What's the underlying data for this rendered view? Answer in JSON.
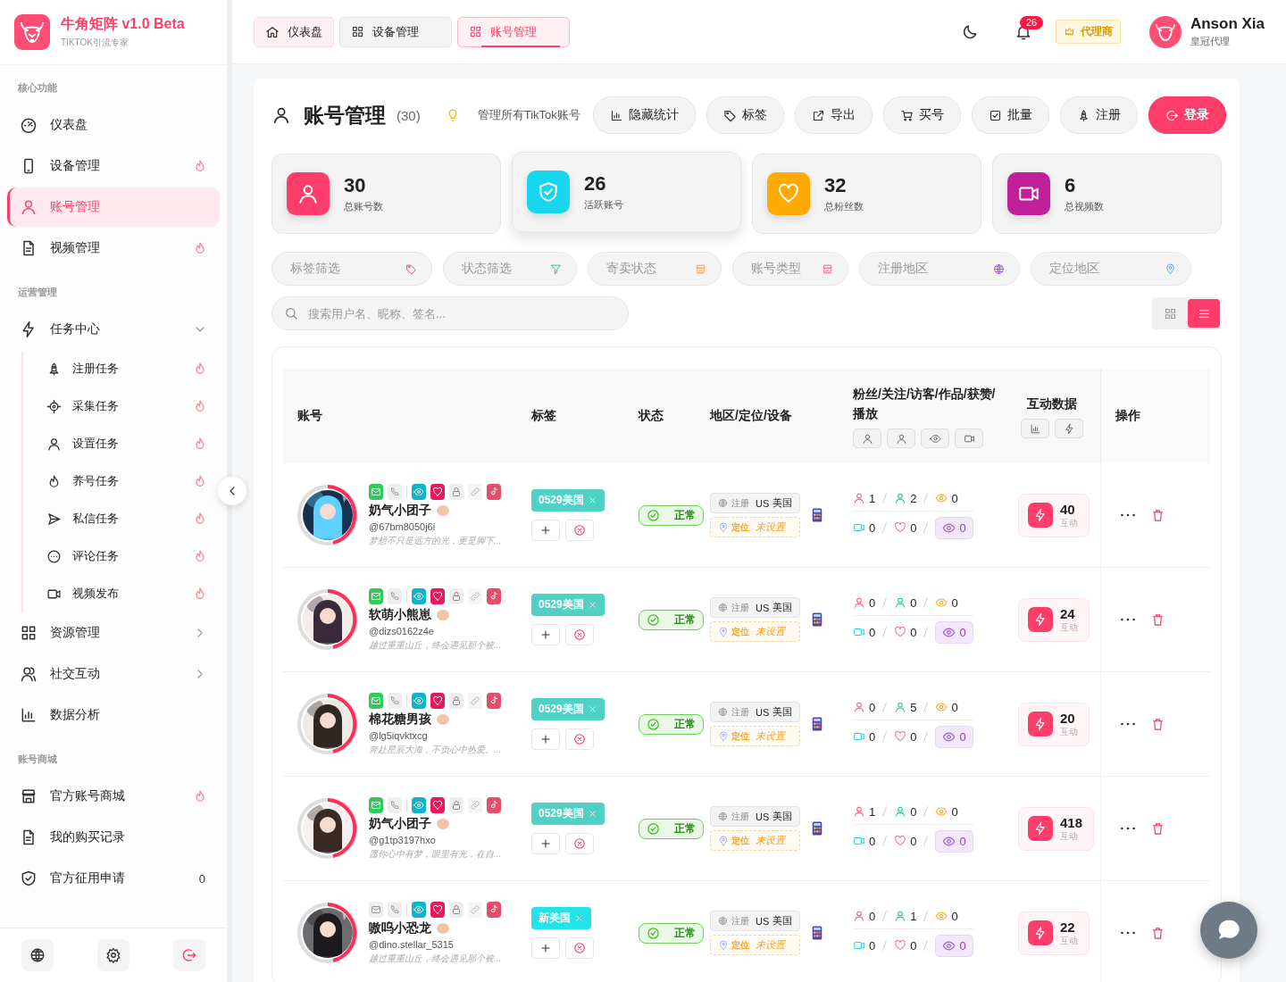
{
  "brand": {
    "name": "牛角矩阵 v1.0 Beta",
    "subtitle": "TIKTOK引流专家"
  },
  "sidebar": {
    "sections": [
      {
        "title": "核心功能",
        "items": [
          {
            "label": "仪表盘",
            "kind": "none",
            "selected": false
          },
          {
            "label": "设备管理",
            "kind": "hot",
            "selected": false
          },
          {
            "label": "账号管理",
            "kind": "none",
            "selected": true
          },
          {
            "label": "视频管理",
            "kind": "hot",
            "selected": false
          }
        ]
      },
      {
        "title": "运营管理",
        "items": [
          {
            "label": "任务中心",
            "kind": "group",
            "expanded": true,
            "selected": false,
            "children": [
              {
                "label": "注册任务",
                "kind": "hot",
                "selected": false
              },
              {
                "label": "采集任务",
                "kind": "hot",
                "selected": false
              },
              {
                "label": "设置任务",
                "kind": "hot",
                "selected": false
              },
              {
                "label": "养号任务",
                "kind": "hot",
                "selected": false
              },
              {
                "label": "私信任务",
                "kind": "hot",
                "selected": false
              },
              {
                "label": "评论任务",
                "kind": "hot",
                "selected": false
              },
              {
                "label": "视频发布",
                "kind": "hot",
                "selected": false
              }
            ]
          },
          {
            "label": "资源管理",
            "kind": "group",
            "expanded": false,
            "selected": false
          },
          {
            "label": "社交互动",
            "kind": "group",
            "expanded": false,
            "selected": false
          },
          {
            "label": "数据分析",
            "kind": "none",
            "selected": false
          }
        ]
      },
      {
        "title": "账号商城",
        "items": [
          {
            "label": "官方账号商城",
            "kind": "hot",
            "selected": false
          },
          {
            "label": "我的购买记录",
            "kind": "none",
            "selected": false
          },
          {
            "label": "官方征用申请",
            "kind": "count",
            "count": "0",
            "selected": false
          }
        ]
      }
    ]
  },
  "tabs": [
    {
      "label": "仪表盘",
      "kind": "home",
      "selected": false
    },
    {
      "label": "设备管理",
      "kind": "page",
      "selected": false
    },
    {
      "label": "账号管理",
      "kind": "page",
      "selected": true
    }
  ],
  "topbar": {
    "notifications": "26",
    "role_badge": "代理商",
    "user_name": "Anson Xia",
    "user_role": "皇冠代理"
  },
  "header": {
    "title": "账号管理",
    "count": "(30)",
    "hint": "管理所有TikTok账号",
    "actions": [
      {
        "label": "隐藏统计",
        "kind": "default"
      },
      {
        "label": "标签",
        "kind": "default"
      },
      {
        "label": "导出",
        "kind": "default"
      },
      {
        "label": "买号",
        "kind": "default"
      },
      {
        "label": "批量",
        "kind": "default"
      },
      {
        "label": "注册",
        "kind": "default"
      },
      {
        "label": "登录",
        "kind": "primary"
      }
    ]
  },
  "stats": [
    {
      "value": "30",
      "label": "总账号数",
      "color": "#ff3d6b",
      "selected": false
    },
    {
      "value": "26",
      "label": "活跃账号",
      "color": "#18d6ee",
      "selected": true
    },
    {
      "value": "32",
      "label": "总粉丝数",
      "color": "#ffaa00",
      "selected": false
    },
    {
      "value": "6",
      "label": "总视频数",
      "color": "#c0209a",
      "selected": false
    }
  ],
  "filters": [
    {
      "placeholder": "标签筛选"
    },
    {
      "placeholder": "状态筛选"
    },
    {
      "placeholder": "寄卖状态"
    },
    {
      "placeholder": "账号类型"
    },
    {
      "placeholder": "注册地区"
    },
    {
      "placeholder": "定位地区"
    }
  ],
  "search": {
    "placeholder": "搜索用户名、昵称、签名..."
  },
  "view_modes": [
    {
      "kind": "grid",
      "selected": false
    },
    {
      "kind": "list",
      "selected": true
    }
  ],
  "table": {
    "columns": [
      "账号",
      "标签",
      "状态",
      "地区/定位/设备",
      "粉丝/关注/访客/作品/获赞/播放",
      "互动数据",
      "操作"
    ],
    "rows": [
      {
        "name": "奶气小团子",
        "handle": "@67bm8050j6i",
        "bio": "梦想不只是远方的光，更是脚下...",
        "mail_verified": true,
        "tag": {
          "label": "0529美国",
          "color": "#4fd1c5"
        },
        "status": "正常",
        "region_label": "注册",
        "region_code": "US",
        "region": "美国",
        "location_label": "定位",
        "location": "未设置",
        "fans": "1",
        "following": "2",
        "visitors": "0",
        "works": "0",
        "likes": "0",
        "plays": "0",
        "interactions": "40",
        "interactions_label": "互动"
      },
      {
        "name": "软萌小熊崽",
        "handle": "@dizs0162z4e",
        "bio": "越过重重山丘，终会遇见那个被...",
        "mail_verified": true,
        "tag": {
          "label": "0529美国",
          "color": "#4fd1c5"
        },
        "status": "正常",
        "region_label": "注册",
        "region_code": "US",
        "region": "美国",
        "location_label": "定位",
        "location": "未设置",
        "fans": "0",
        "following": "0",
        "visitors": "0",
        "works": "0",
        "likes": "0",
        "plays": "0",
        "interactions": "24",
        "interactions_label": "互动"
      },
      {
        "name": "棉花糖男孩",
        "handle": "@lg5iqvktxcg",
        "bio": "奔赴星辰大海，不负心中热爱。...",
        "mail_verified": true,
        "tag": {
          "label": "0529美国",
          "color": "#4fd1c5"
        },
        "status": "正常",
        "region_label": "注册",
        "region_code": "US",
        "region": "美国",
        "location_label": "定位",
        "location": "未设置",
        "fans": "0",
        "following": "5",
        "visitors": "0",
        "works": "0",
        "likes": "0",
        "plays": "0",
        "interactions": "20",
        "interactions_label": "互动"
      },
      {
        "name": "奶气小团子",
        "handle": "@g1tp3197hxo",
        "bio": "愿你心中有梦，眼里有光，在自...",
        "mail_verified": true,
        "tag": {
          "label": "0529美国",
          "color": "#4fd1c5"
        },
        "status": "正常",
        "region_label": "注册",
        "region_code": "US",
        "region": "美国",
        "location_label": "定位",
        "location": "未设置",
        "fans": "1",
        "following": "0",
        "visitors": "0",
        "works": "0",
        "likes": "0",
        "plays": "0",
        "interactions": "418",
        "interactions_label": "互动"
      },
      {
        "name": "嗷呜小恐龙",
        "handle": "@dino.stellar_5315",
        "bio": "越过重重山丘，终会遇见那个被...",
        "mail_verified": false,
        "tag": {
          "label": "新美国",
          "color": "#22e3ea"
        },
        "status": "正常",
        "region_label": "注册",
        "region_code": "US",
        "region": "美国",
        "location_label": "定位",
        "location": "未设置",
        "fans": "0",
        "following": "1",
        "visitors": "0",
        "works": "0",
        "likes": "0",
        "plays": "0",
        "interactions": "22",
        "interactions_label": "互动"
      }
    ]
  }
}
